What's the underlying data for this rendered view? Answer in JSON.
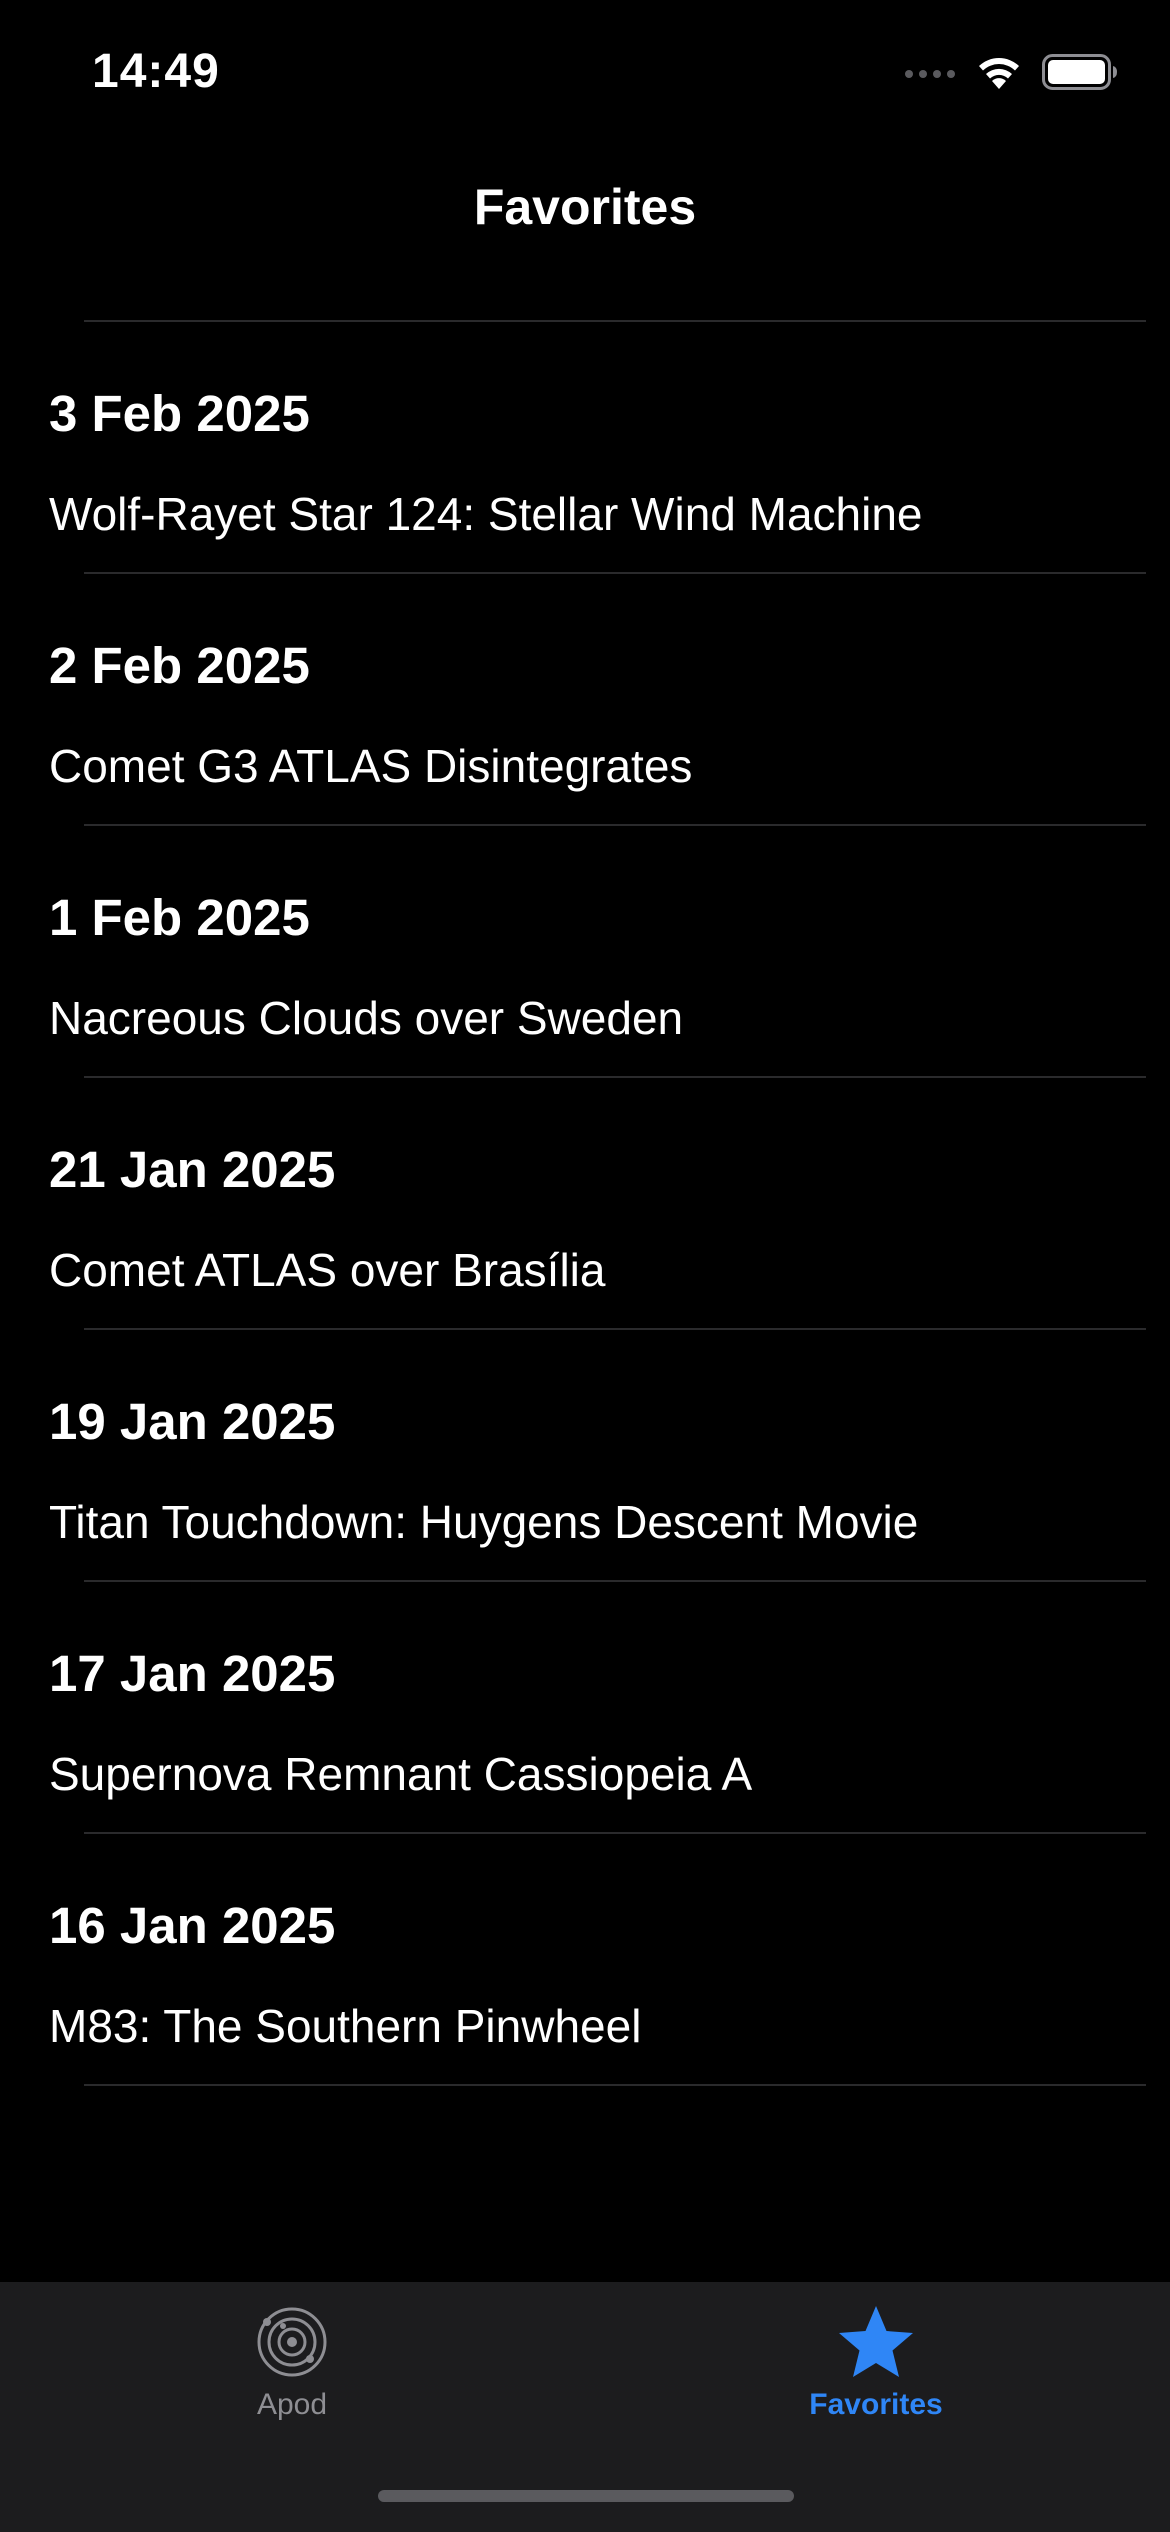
{
  "status_bar": {
    "time": "14:49"
  },
  "nav": {
    "title": "Favorites"
  },
  "favorites": [
    {
      "date": "3 Feb 2025",
      "title": "Wolf-Rayet Star 124: Stellar Wind Machine"
    },
    {
      "date": "2 Feb 2025",
      "title": "Comet G3 ATLAS Disintegrates"
    },
    {
      "date": "1 Feb 2025",
      "title": "Nacreous Clouds over Sweden"
    },
    {
      "date": "21 Jan 2025",
      "title": "Comet ATLAS over Brasília"
    },
    {
      "date": "19 Jan 2025",
      "title": "Titan Touchdown: Huygens Descent Movie"
    },
    {
      "date": "17 Jan 2025",
      "title": "Supernova Remnant Cassiopeia A"
    },
    {
      "date": "16 Jan 2025",
      "title": "M83: The Southern Pinwheel"
    }
  ],
  "tab_bar": {
    "tabs": [
      {
        "label": "Apod",
        "icon": "orbit-icon",
        "selected": false
      },
      {
        "label": "Favorites",
        "icon": "star-icon",
        "selected": true
      }
    ]
  },
  "colors": {
    "background": "#000000",
    "tab_bar": "#1c1c1e",
    "accent": "#2f86f6",
    "inactive": "#8e8e93"
  }
}
